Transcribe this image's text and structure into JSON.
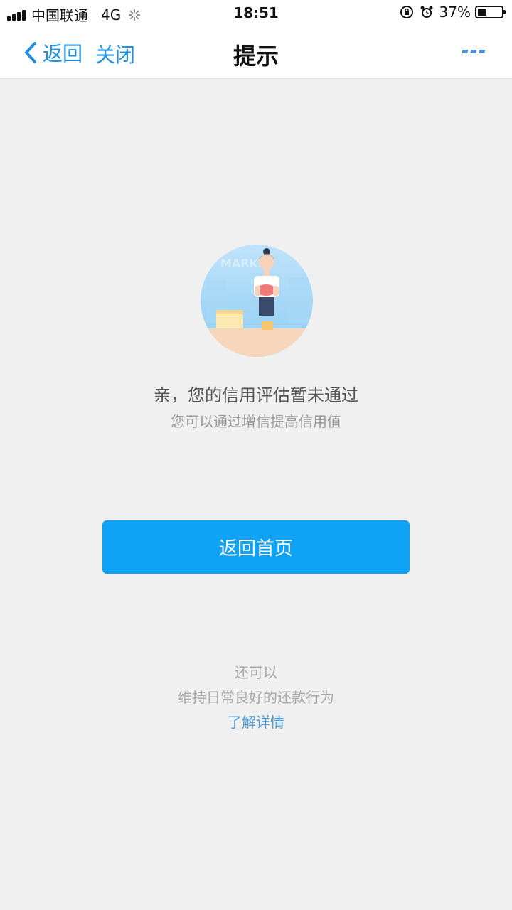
{
  "status_bar": {
    "carrier": "中国联通",
    "network": "4G",
    "time": "18:51",
    "battery_percent": "37%",
    "battery_level": 0.37
  },
  "nav": {
    "back_label": "返回",
    "close_label": "关闭",
    "title": "提示",
    "accent_color": "#1e8fe1"
  },
  "main": {
    "illustration_icon": "shop-assistant-illustration",
    "message": "亲，您的信用评估暂未通过",
    "sub_message": "您可以通过增信提高信用值",
    "home_button_label": "返回首页",
    "button_color": "#10a2f5"
  },
  "footer": {
    "also_text": "还可以",
    "tip_text": "维持日常良好的还款行为",
    "detail_link": "了解详情"
  }
}
